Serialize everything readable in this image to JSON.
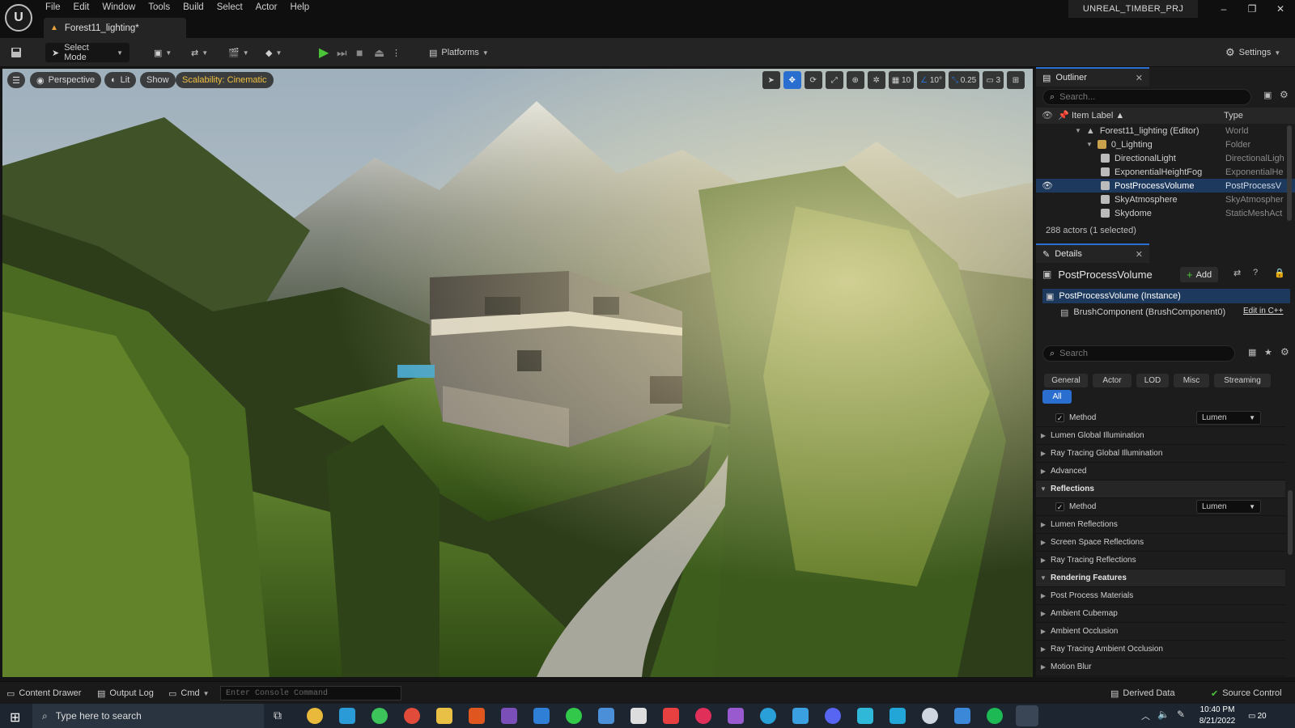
{
  "menu": [
    "File",
    "Edit",
    "Window",
    "Tools",
    "Build",
    "Select",
    "Actor",
    "Help"
  ],
  "doc_tab": "Forest11_lighting*",
  "project_name": "UNREAL_TIMBER_PRJ",
  "toolbar": {
    "select_mode": "Select Mode",
    "platforms": "Platforms",
    "settings": "Settings"
  },
  "viewport": {
    "perspective": "Perspective",
    "lit": "Lit",
    "show": "Show",
    "scalability": "Scalability: Cinematic",
    "grid_value": "10",
    "angle_value": "10°",
    "scale_value": "0.25",
    "camera_speed": "3"
  },
  "outliner": {
    "title": "Outliner",
    "search_placeholder": "Search...",
    "col_label": "Item Label ▲",
    "col_type": "Type",
    "rows": [
      {
        "label": "Forest11_lighting (Editor)",
        "type": "World"
      },
      {
        "label": "0_Lighting",
        "type": "Folder"
      },
      {
        "label": "DirectionalLight",
        "type": "DirectionalLigh"
      },
      {
        "label": "ExponentialHeightFog",
        "type": "ExponentialHe"
      },
      {
        "label": "PostProcessVolume",
        "type": "PostProcessV"
      },
      {
        "label": "SkyAtmosphere",
        "type": "SkyAtmospher"
      },
      {
        "label": "Skydome",
        "type": "StaticMeshAct"
      }
    ],
    "status": "288 actors (1 selected)"
  },
  "details": {
    "title": "Details",
    "actor_name": "PostProcessVolume",
    "add_label": "Add",
    "instance": "PostProcessVolume (Instance)",
    "component": "BrushComponent (BrushComponent0)",
    "edit_cpp": "Edit in C++",
    "search_placeholder": "Search",
    "filters": [
      "General",
      "Actor",
      "LOD",
      "Misc",
      "Streaming"
    ],
    "filter_all": "All",
    "rows": [
      {
        "label": "Method",
        "value": "Lumen"
      },
      {
        "label": "Lumen Global Illumination"
      },
      {
        "label": "Ray Tracing Global Illumination"
      },
      {
        "label": "Advanced"
      },
      {
        "label": "Reflections"
      },
      {
        "label": "Method",
        "value": "Lumen"
      },
      {
        "label": "Lumen Reflections"
      },
      {
        "label": "Screen Space Reflections"
      },
      {
        "label": "Ray Tracing Reflections"
      },
      {
        "label": "Rendering Features"
      },
      {
        "label": "Post Process Materials"
      },
      {
        "label": "Ambient Cubemap"
      },
      {
        "label": "Ambient Occlusion"
      },
      {
        "label": "Ray Tracing Ambient Occlusion"
      },
      {
        "label": "Motion Blur"
      }
    ]
  },
  "bottom": {
    "content_drawer": "Content Drawer",
    "output_log": "Output Log",
    "cmd": "Cmd",
    "console_placeholder": "Enter Console Command",
    "derived_data": "Derived Data",
    "source_control": "Source Control"
  },
  "taskbar": {
    "search": "Type here to search",
    "time": "10:40 PM",
    "date": "8/21/2022",
    "notif": "20"
  }
}
